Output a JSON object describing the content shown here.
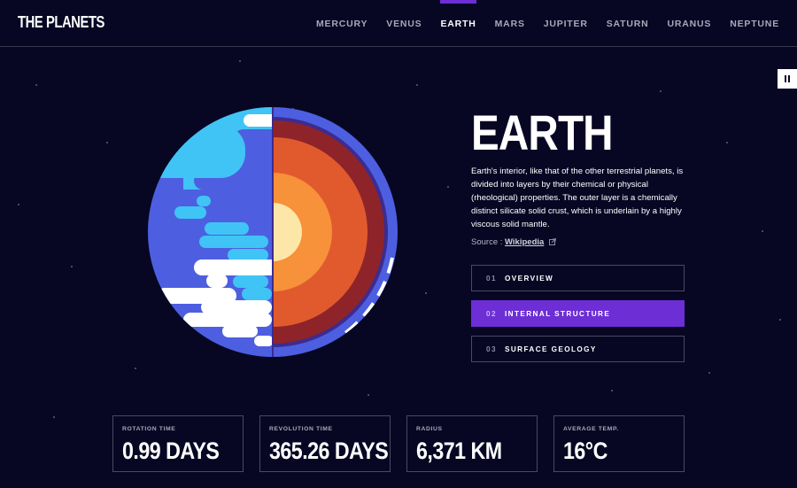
{
  "brand": {
    "logo": "THE PLANETS"
  },
  "nav": {
    "items": [
      {
        "label": "MERCURY"
      },
      {
        "label": "VENUS"
      },
      {
        "label": "EARTH"
      },
      {
        "label": "MARS"
      },
      {
        "label": "JUPITER"
      },
      {
        "label": "SATURN"
      },
      {
        "label": "URANUS"
      },
      {
        "label": "NEPTUNE"
      }
    ],
    "active": "EARTH"
  },
  "controls": {
    "pause_icon": "pause-icon"
  },
  "planet": {
    "name": "EARTH",
    "description": "Earth's interior, like that of the other terrestrial planets, is divided into layers by their chemical or physical (rheological) properties. The outer layer is a chemically distinct silicate solid crust, which is underlain by a highly viscous solid mantle.",
    "source_label": "Source :",
    "source_link": "Wikipedia",
    "source_icon": "external-link-icon",
    "image": "earth-internal-structure-illustration"
  },
  "tabs": [
    {
      "num": "01",
      "label": "OVERVIEW",
      "active": false
    },
    {
      "num": "02",
      "label": "INTERNAL STRUCTURE",
      "active": true
    },
    {
      "num": "03",
      "label": "SURFACE GEOLOGY",
      "active": false
    }
  ],
  "stats": [
    {
      "label": "ROTATION TIME",
      "value": "0.99 DAYS"
    },
    {
      "label": "REVOLUTION TIME",
      "value": "365.26 DAYS"
    },
    {
      "label": "RADIUS",
      "value": "6,371 KM"
    },
    {
      "label": "AVERAGE TEMP.",
      "value": "16°C"
    }
  ],
  "colors": {
    "background": "#070724",
    "accent": "#6d2ed5",
    "border": "#494963"
  }
}
